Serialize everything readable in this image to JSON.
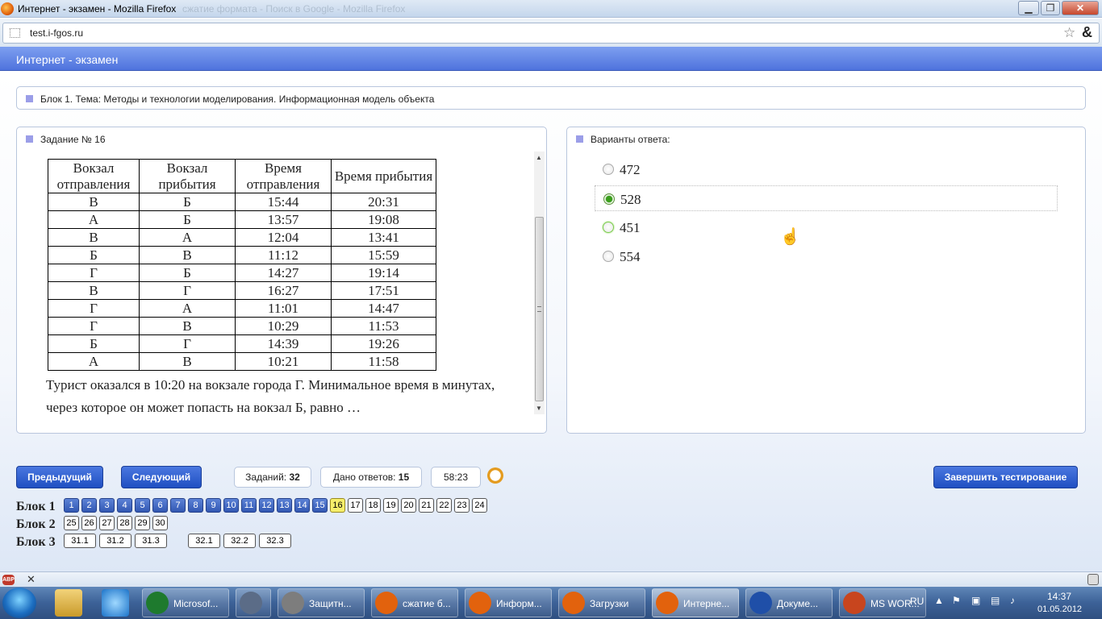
{
  "window": {
    "title": "Интернет - экзамен - Mozilla Firefox",
    "ghost_title": "сжатие формата - Поиск в Google - Mozilla Firefox"
  },
  "window_buttons": {
    "minimize": "▁",
    "maximize": "❐",
    "close": "✕"
  },
  "browser": {
    "url": "test.i-fgos.ru",
    "star": "☆",
    "addon": "&"
  },
  "app": {
    "header": "Интернет - экзамен"
  },
  "block_title": "Блок 1. Тема: Методы и технологии моделирования. Информационная модель объекта",
  "question": {
    "label": "Задание № 16",
    "headers": [
      "Вокзал отправления",
      "Вокзал прибытия",
      "Время отправления",
      "Время прибытия"
    ],
    "rows": [
      [
        "В",
        "Б",
        "15:44",
        "20:31"
      ],
      [
        "А",
        "Б",
        "13:57",
        "19:08"
      ],
      [
        "В",
        "А",
        "12:04",
        "13:41"
      ],
      [
        "Б",
        "В",
        "11:12",
        "15:59"
      ],
      [
        "Г",
        "Б",
        "14:27",
        "19:14"
      ],
      [
        "В",
        "Г",
        "16:27",
        "17:51"
      ],
      [
        "Г",
        "А",
        "11:01",
        "14:47"
      ],
      [
        "Г",
        "В",
        "10:29",
        "11:53"
      ],
      [
        "Б",
        "Г",
        "14:39",
        "19:26"
      ],
      [
        "А",
        "В",
        "10:21",
        "11:58"
      ]
    ],
    "text": "Турист оказался в 10:20 на вокзале города Г. Минимальное время в минутах, через которое он может попасть на вокзал Б, равно …"
  },
  "answers": {
    "label": "Варианты ответа:",
    "options": [
      {
        "value": "472",
        "state": "none"
      },
      {
        "value": "528",
        "state": "selected"
      },
      {
        "value": "451",
        "state": "hover"
      },
      {
        "value": "554",
        "state": "none"
      }
    ]
  },
  "nav": {
    "prev": "Предыдущий",
    "next": "Следующий",
    "tasks_label": "Заданий:",
    "tasks_value": "32",
    "answered_label": "Дано ответов:",
    "answered_value": "15",
    "timer": "58:23",
    "finish": "Завершить тестирование"
  },
  "blocks": [
    {
      "label": "Блок 1",
      "items": [
        "1",
        "2",
        "3",
        "4",
        "5",
        "6",
        "7",
        "8",
        "9",
        "10",
        "11",
        "12",
        "13",
        "14",
        "15",
        "16",
        "17",
        "18",
        "19",
        "20",
        "21",
        "22",
        "23",
        "24"
      ],
      "done_through": 15,
      "current": "16"
    },
    {
      "label": "Блок 2",
      "items": [
        "25",
        "26",
        "27",
        "28",
        "29",
        "30"
      ]
    },
    {
      "label": "Блок 3",
      "items": [
        "31.1",
        "31.2",
        "31.3",
        "32.1",
        "32.2",
        "32.3"
      ]
    }
  ],
  "addon_bar": {
    "abp": "ABP",
    "close": "✕"
  },
  "taskbar": {
    "items": [
      {
        "label": "Microsof...",
        "icon": "excel-icon",
        "color": "#1e7a2e"
      },
      {
        "label": "",
        "icon": "m-icon",
        "color": "#5b6c87"
      },
      {
        "label": "Защитн...",
        "icon": "wall-icon",
        "color": "#7d7d7d"
      },
      {
        "label": "сжатие б...",
        "icon": "firefox-icon",
        "color": "#e2620d"
      },
      {
        "label": "Информ...",
        "icon": "firefox-icon",
        "color": "#e2620d"
      },
      {
        "label": "Загрузки",
        "icon": "firefox-icon",
        "color": "#e2620d"
      },
      {
        "label": "Интерне...",
        "icon": "firefox-icon",
        "color": "#e2620d",
        "active": true
      },
      {
        "label": "Докуме...",
        "icon": "word-icon",
        "color": "#1f4fa8"
      },
      {
        "label": "MS WOR...",
        "icon": "powerpoint-icon",
        "color": "#c8451e"
      }
    ],
    "lang": "RU",
    "time": "14:37",
    "date": "01.05.2012"
  }
}
